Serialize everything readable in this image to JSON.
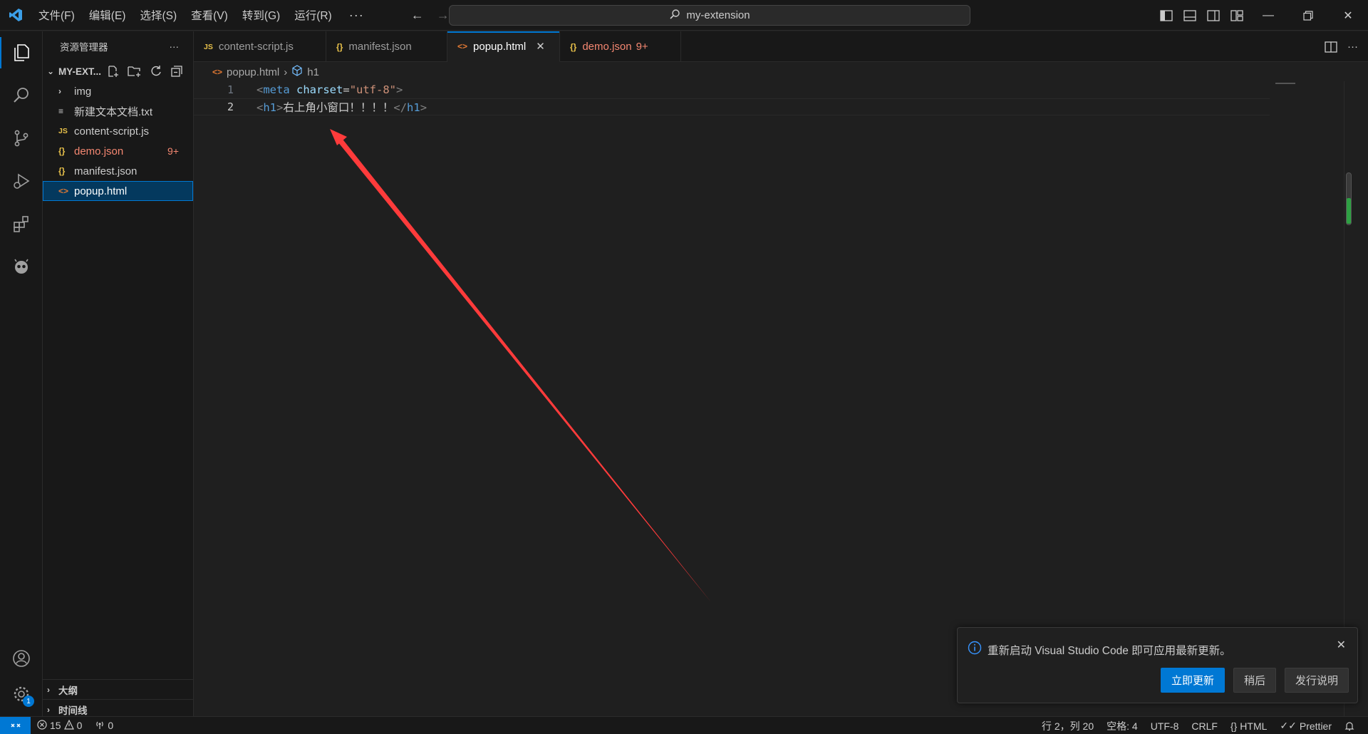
{
  "titlebar": {
    "menu": [
      "文件(F)",
      "编辑(E)",
      "选择(S)",
      "查看(V)",
      "转到(G)",
      "运行(R)"
    ],
    "more": "···",
    "search_text": "my-extension"
  },
  "sidebar": {
    "title": "资源管理器",
    "more": "···",
    "project": "MY-EXT...",
    "files": [
      {
        "name": "img",
        "type": "folder"
      },
      {
        "name": "新建文本文档.txt",
        "type": "txt"
      },
      {
        "name": "content-script.js",
        "type": "js"
      },
      {
        "name": "demo.json",
        "type": "json",
        "problems": "9+"
      },
      {
        "name": "manifest.json",
        "type": "json"
      },
      {
        "name": "popup.html",
        "type": "html",
        "selected": true
      }
    ],
    "outline": "大纲",
    "timeline": "时间线"
  },
  "tabs": [
    {
      "label": "content-script.js",
      "icon": "JS"
    },
    {
      "label": "manifest.json",
      "icon": "{}"
    },
    {
      "label": "popup.html",
      "icon": "<>",
      "active": true
    },
    {
      "label": "demo.json",
      "icon": "{}",
      "problems": "9+"
    }
  ],
  "breadcrumb": {
    "file": "popup.html",
    "symbol": "h1"
  },
  "editor": {
    "line_numbers": [
      "1",
      "2"
    ],
    "line1": {
      "open": "<",
      "tag": "meta",
      "attr": "charset",
      "eq": "=",
      "value": "\"utf-8\"",
      "close": ">"
    },
    "line2": {
      "open": "<",
      "tag": "h1",
      "close": ">",
      "text": "右上角小窗口！！！！",
      "end_open": "</",
      "end_tag": "h1",
      "end_close": ">"
    }
  },
  "toast": {
    "message": "重新启动 Visual Studio Code 即可应用最新更新。",
    "primary": "立即更新",
    "later": "稍后",
    "notes": "发行说明"
  },
  "statusbar": {
    "errors": "15",
    "warnings": "0",
    "ports": "0",
    "position": "行 2，列 20",
    "spaces": "空格: 4",
    "encoding": "UTF-8",
    "eol": "CRLF",
    "language": "HTML",
    "prettier": "Prettier",
    "settings_badge": "1"
  },
  "colors": {
    "accent": "#0078d4",
    "error": "#f48771",
    "annotation_arrow": "#ff3b3b"
  }
}
